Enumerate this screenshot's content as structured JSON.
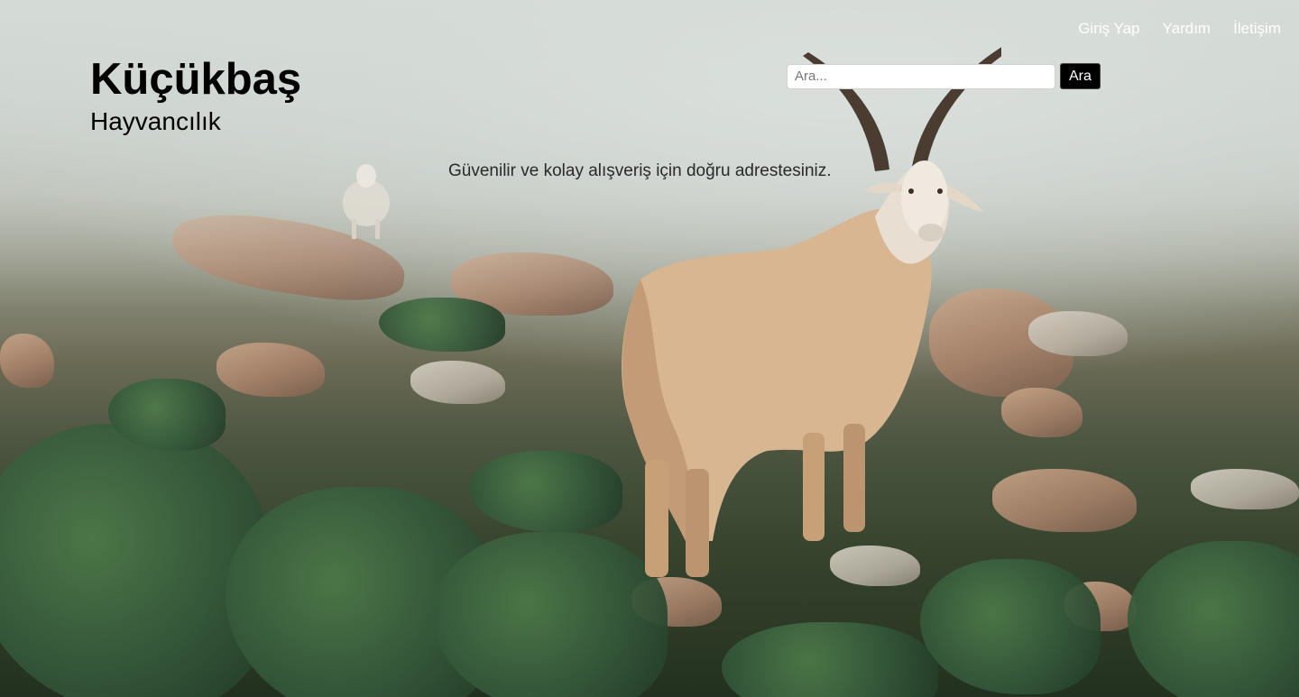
{
  "nav": {
    "items": [
      {
        "label": "Giriş Yap"
      },
      {
        "label": "Yardım"
      },
      {
        "label": "İletişim"
      }
    ]
  },
  "brand": {
    "title": "Küçükbaş",
    "subtitle": "Hayvancılık"
  },
  "search": {
    "placeholder": "Ara...",
    "value": "",
    "button_label": "Ara"
  },
  "hero": {
    "tagline": "Güvenilir ve kolay alışveriş için doğru adrestesiniz."
  },
  "colors": {
    "brand_text": "#000000",
    "nav_text": "#ffffff",
    "button_bg": "#000000"
  }
}
